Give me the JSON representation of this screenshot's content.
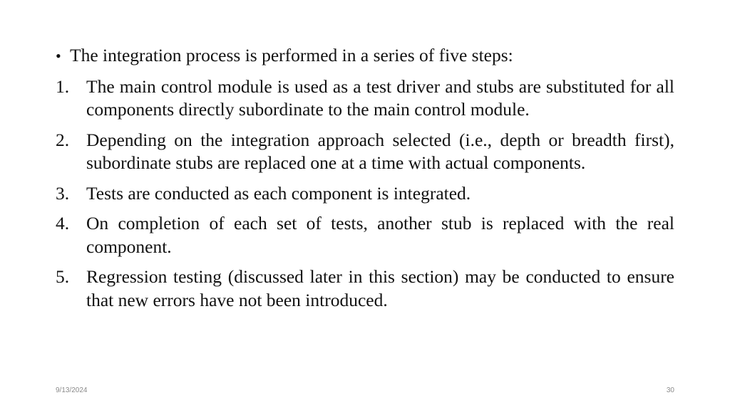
{
  "slide": {
    "intro": {
      "bullet": "•",
      "text": "The integration process is performed in a series of five steps:"
    },
    "steps": [
      {
        "number": "1.",
        "text": "The main control module is used as a test driver and stubs are substituted for all components directly subordinate to the main control module."
      },
      {
        "number": "2.",
        "text": "Depending on the integration approach selected (i.e., depth or breadth first), subordinate stubs are replaced one at a time with actual components."
      },
      {
        "number": "3.",
        "text": "Tests are conducted as each component is integrated."
      },
      {
        "number": "4.",
        "text": "On completion of each set of tests, another stub is replaced with the real component."
      },
      {
        "number": "5.",
        "text": "Regression testing (discussed later in this section) may be conducted to ensure that new errors have not been introduced."
      }
    ]
  },
  "footer": {
    "date": "9/13/2024",
    "page_number": "30"
  }
}
